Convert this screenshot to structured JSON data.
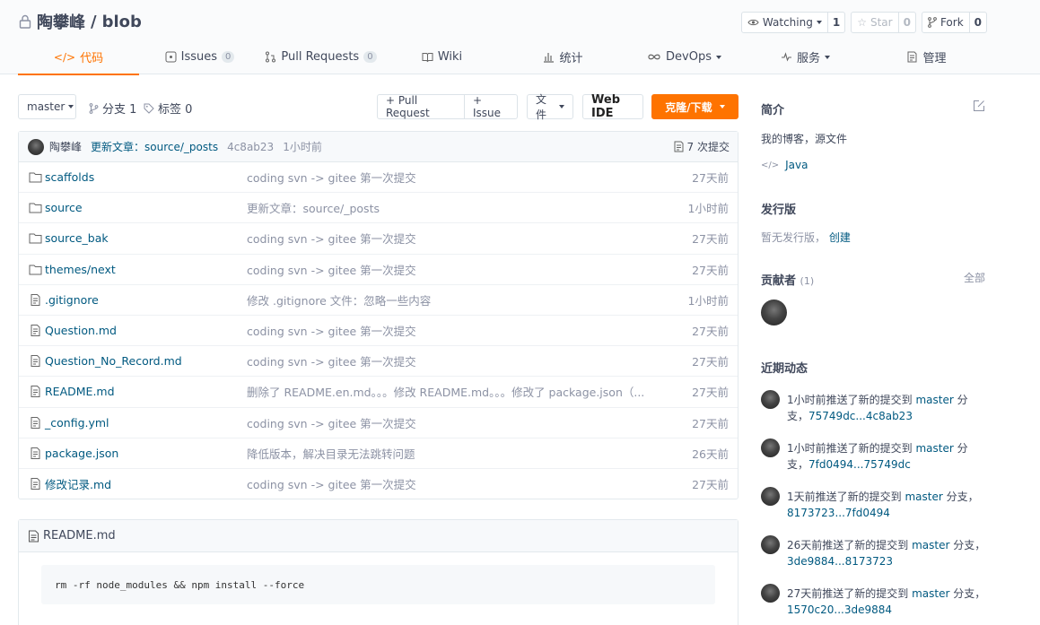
{
  "repo": {
    "owner": "陶攀峰",
    "separator": "/",
    "name": "blob"
  },
  "actions": {
    "watch": {
      "label": "Watching",
      "count": "1"
    },
    "star": {
      "label": "Star",
      "count": "0"
    },
    "fork": {
      "label": "Fork",
      "count": "0"
    }
  },
  "tabs": [
    {
      "label": "代码",
      "badge": ""
    },
    {
      "label": "Issues",
      "badge": "0"
    },
    {
      "label": "Pull Requests",
      "badge": "0"
    },
    {
      "label": "Wiki",
      "badge": ""
    },
    {
      "label": "统计",
      "badge": ""
    },
    {
      "label": "DevOps",
      "badge": ""
    },
    {
      "label": "服务",
      "badge": ""
    },
    {
      "label": "管理",
      "badge": ""
    }
  ],
  "toolbar": {
    "branch": "master",
    "branches": "分支 1",
    "tags": "标签 0",
    "pull_request": "+ Pull Request",
    "issue": "+ Issue",
    "files": "文件",
    "web_ide": "Web IDE",
    "clone": "克隆/下载"
  },
  "last_commit": {
    "author": "陶攀峰",
    "message": "更新文章：source/_posts",
    "sha": "4c8ab23",
    "time": "1小时前",
    "commit_count": "7 次提交"
  },
  "files": [
    {
      "name": "scaffolds",
      "type": "folder",
      "message": "coding svn -> gitee 第一次提交",
      "time": "27天前"
    },
    {
      "name": "source",
      "type": "folder",
      "message": "更新文章：source/_posts",
      "time": "1小时前"
    },
    {
      "name": "source_bak",
      "type": "folder",
      "message": "coding svn -> gitee 第一次提交",
      "time": "27天前"
    },
    {
      "name": "themes/next",
      "type": "folder",
      "message": "coding svn -> gitee 第一次提交",
      "time": "27天前"
    },
    {
      "name": ".gitignore",
      "type": "file",
      "message": "修改 .gitignore 文件：忽略一些内容",
      "time": "1小时前"
    },
    {
      "name": "Question.md",
      "type": "file",
      "message": "coding svn -> gitee 第一次提交",
      "time": "27天前"
    },
    {
      "name": "Question_No_Record.md",
      "type": "file",
      "message": "coding svn -> gitee 第一次提交",
      "time": "27天前"
    },
    {
      "name": "README.md",
      "type": "file",
      "message": "删除了 README.en.md。。。修改 README.md。。。修改了 package.json（...",
      "time": "27天前"
    },
    {
      "name": "_config.yml",
      "type": "file",
      "message": "coding svn -> gitee 第一次提交",
      "time": "27天前"
    },
    {
      "name": "package.json",
      "type": "file",
      "message": "降低版本，解决目录无法跳转问题",
      "time": "26天前"
    },
    {
      "name": "修改记录.md",
      "type": "file",
      "message": "coding svn -> gitee 第一次提交",
      "time": "27天前"
    }
  ],
  "readme": {
    "title": "README.md",
    "code": "rm -rf node_modules && npm install --force"
  },
  "sidebar": {
    "intro_title": "简介",
    "intro_text": "我的博客，源文件",
    "language": "Java",
    "release_title": "发行版",
    "release_text": "暂无发行版，",
    "release_create": "创建",
    "contributors_title": "贡献者",
    "contributors_count": "(1)",
    "contributors_all": "全部",
    "activity_title": "近期动态",
    "activity": [
      {
        "text": "1小时前推送了新的提交到 ",
        "branch": "master",
        "suffix": " 分支，",
        "range": "75749dc...4c8ab23"
      },
      {
        "text": "1小时前推送了新的提交到 ",
        "branch": "master",
        "suffix": " 分支，",
        "range": "7fd0494...75749dc"
      },
      {
        "text": "1天前推送了新的提交到 ",
        "branch": "master",
        "suffix": " 分支，",
        "range": "8173723...7fd0494"
      },
      {
        "text": "26天前推送了新的提交到 ",
        "branch": "master",
        "suffix": " 分支，",
        "range": "3de9884...8173723"
      },
      {
        "text": "27天前推送了新的提交到 ",
        "branch": "master",
        "suffix": " 分支，",
        "range": "1570c20...3de9884"
      }
    ]
  },
  "colors": {
    "accent": "#fe7300",
    "link": "#005980",
    "muted": "#8c92a4"
  }
}
